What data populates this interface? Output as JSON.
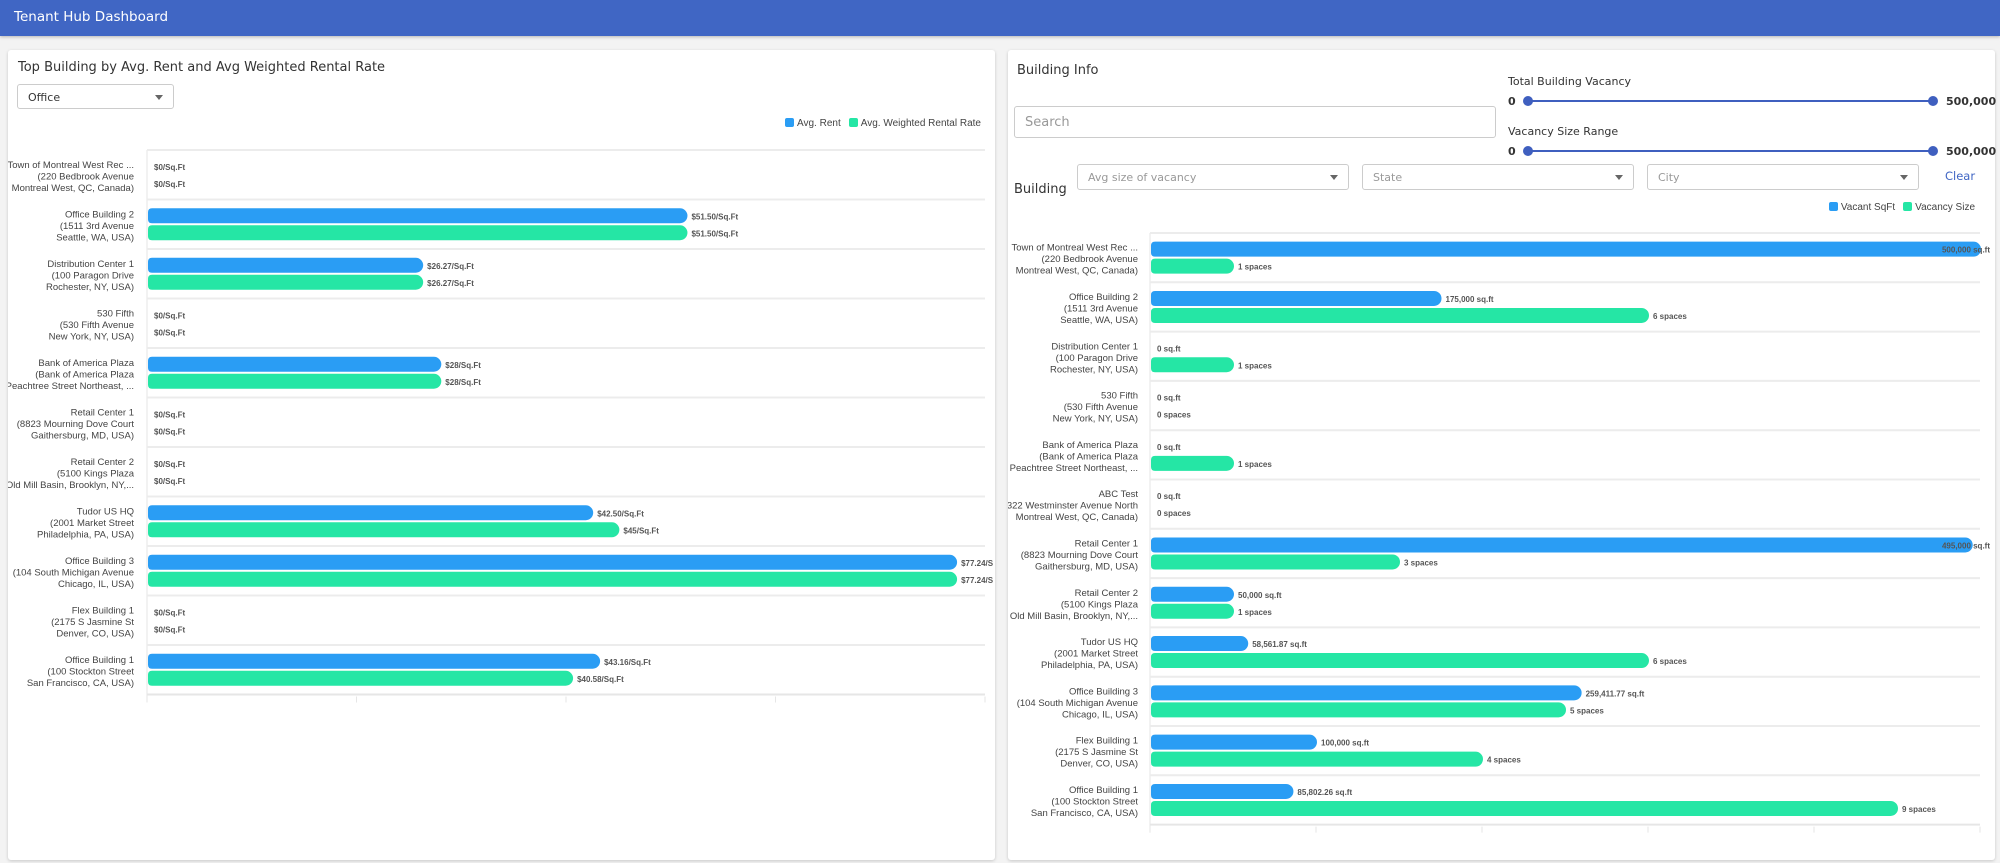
{
  "app": {
    "title": "Tenant Hub Dashboard"
  },
  "colors": {
    "header": "#4066c4",
    "series_blue": "#2a9df4",
    "series_green": "#25e6a5",
    "accent": "#3f5fbf"
  },
  "left_panel": {
    "title": "Top Building by Avg. Rent and Avg Weighted Rental Rate",
    "type_select": {
      "value": "Office"
    }
  },
  "right_panel": {
    "title": "Building Info",
    "search": {
      "placeholder": "Search",
      "value": ""
    },
    "total_vacancy": {
      "label": "Total Building Vacancy",
      "min_label": "0",
      "max_label": "500,000",
      "min": 0,
      "max": 500000,
      "low": 0,
      "high": 500000
    },
    "vacancy_size": {
      "label": "Vacancy Size Range",
      "min_label": "0",
      "max_label": "500,000",
      "min": 0,
      "max": 500000,
      "low": 0,
      "high": 500000
    },
    "filter_label": "Building",
    "filters": [
      {
        "name": "avg-size-of-vacancy",
        "placeholder": "Avg size of vacancy"
      },
      {
        "name": "state",
        "placeholder": "State"
      },
      {
        "name": "city",
        "placeholder": "City"
      }
    ],
    "clear_label": "Clear"
  },
  "chart_data": [
    {
      "type": "bar",
      "orientation": "horizontal",
      "title": "Top Building by Avg. Rent and Avg Weighted Rental Rate",
      "xlim": [
        0,
        80
      ],
      "xticks": [
        0,
        20,
        40,
        60,
        80
      ],
      "legend": "top-right",
      "grid": false,
      "categories": [
        [
          "Town of Montreal West Rec ...",
          "(220 Bedbrook Avenue",
          "Montreal West, QC, Canada)"
        ],
        [
          "Office Building 2",
          "(1511 3rd Avenue",
          "Seattle, WA, USA)"
        ],
        [
          "Distribution Center 1",
          "(100 Paragon Drive",
          "Rochester, NY, USA)"
        ],
        [
          "530 Fifth",
          "(530 Fifth Avenue",
          "New York, NY, USA)"
        ],
        [
          "Bank of America Plaza",
          "(Bank of America Plaza",
          "Peachtree Street Northeast, ..."
        ],
        [
          "Retail Center 1",
          "(8823 Mourning Dove Court",
          "Gaithersburg, MD, USA)"
        ],
        [
          "Retail Center 2",
          "(5100 Kings Plaza",
          "Old Mill Basin, Brooklyn, NY,..."
        ],
        [
          "Tudor US HQ",
          "(2001 Market Street",
          "Philadelphia, PA, USA)"
        ],
        [
          "Office Building 3",
          "(104 South Michigan Avenue",
          "Chicago, IL, USA)"
        ],
        [
          "Flex Building 1",
          "(2175 S Jasmine St",
          "Denver, CO, USA)"
        ],
        [
          "Office Building 1",
          "(100 Stockton Street",
          "San Francisco, CA, USA)"
        ]
      ],
      "series": [
        {
          "name": "Avg. Rent",
          "color": "#2a9df4",
          "values": [
            0,
            51.5,
            26.27,
            0,
            28,
            0,
            0,
            42.5,
            77.24,
            0,
            43.16
          ],
          "labels": [
            "$0/Sq.Ft",
            "$51.50/Sq.Ft",
            "$26.27/Sq.Ft",
            "$0/Sq.Ft",
            "$28/Sq.Ft",
            "$0/Sq.Ft",
            "$0/Sq.Ft",
            "$42.50/Sq.Ft",
            "$77.24/S",
            "$0/Sq.Ft",
            "$43.16/Sq.Ft"
          ]
        },
        {
          "name": "Avg. Weighted Rental Rate",
          "color": "#25e6a5",
          "values": [
            0,
            51.5,
            26.27,
            0,
            28,
            0,
            0,
            45,
            77.24,
            0,
            40.58
          ],
          "labels": [
            "$0/Sq.Ft",
            "$51.50/Sq.Ft",
            "$26.27/Sq.Ft",
            "$0/Sq.Ft",
            "$28/Sq.Ft",
            "$0/Sq.Ft",
            "$0/Sq.Ft",
            "$45/Sq.Ft",
            "$77.24/S",
            "$0/Sq.Ft",
            "$40.58/Sq.Ft"
          ]
        }
      ]
    },
    {
      "type": "bar",
      "orientation": "horizontal",
      "title": "Building Info",
      "legend": "top-right",
      "grid": false,
      "categories": [
        [
          "Town of Montreal West Rec ...",
          "(220 Bedbrook Avenue",
          "Montreal West, QC, Canada)"
        ],
        [
          "Office Building 2",
          "(1511 3rd Avenue",
          "Seattle, WA, USA)"
        ],
        [
          "Distribution Center 1",
          "(100 Paragon Drive",
          "Rochester, NY, USA)"
        ],
        [
          "530 Fifth",
          "(530 Fifth Avenue",
          "New York, NY, USA)"
        ],
        [
          "Bank of America Plaza",
          "(Bank of America Plaza",
          "Peachtree Street Northeast, ..."
        ],
        [
          "ABC Test",
          "(322 Westminster Avenue North",
          "Montreal West, QC, Canada)"
        ],
        [
          "Retail Center 1",
          "(8823 Mourning Dove Court",
          "Gaithersburg, MD, USA)"
        ],
        [
          "Retail Center 2",
          "(5100 Kings Plaza",
          "Old Mill Basin, Brooklyn, NY,..."
        ],
        [
          "Tudor US HQ",
          "(2001 Market Street",
          "Philadelphia, PA, USA)"
        ],
        [
          "Office Building 3",
          "(104 South Michigan Avenue",
          "Chicago, IL, USA)"
        ],
        [
          "Flex Building 1",
          "(2175 S Jasmine St",
          "Denver, CO, USA)"
        ],
        [
          "Office Building 1",
          "(100 Stockton Street",
          "San Francisco, CA, USA)"
        ]
      ],
      "series": [
        {
          "name": "Vacant SqFt",
          "color": "#2a9df4",
          "xlim": [
            0,
            500000
          ],
          "values": [
            500000,
            175000,
            0,
            0,
            0,
            0,
            495000,
            50000,
            58561.87,
            259411.77,
            100000,
            85802.26
          ],
          "labels": [
            "500,000 sq.ft",
            "175,000 sq.ft",
            "0 sq.ft",
            "0 sq.ft",
            "0 sq.ft",
            "0 sq.ft",
            "495,000 sq.ft",
            "50,000 sq.ft",
            "58,561.87 sq.ft",
            "259,411.77 sq.ft",
            "100,000 sq.ft",
            "85,802.26 sq.ft"
          ]
        },
        {
          "name": "Vacancy Size",
          "color": "#25e6a5",
          "xlim": [
            0,
            10
          ],
          "values": [
            1,
            6,
            1,
            0,
            1,
            0,
            3,
            1,
            6,
            5,
            4,
            9
          ],
          "labels": [
            "1 spaces",
            "6 spaces",
            "1 spaces",
            "0 spaces",
            "1 spaces",
            "0 spaces",
            "3 spaces",
            "1 spaces",
            "6 spaces",
            "5 spaces",
            "4 spaces",
            "9 spaces"
          ]
        }
      ],
      "xticks_count": 5
    }
  ]
}
